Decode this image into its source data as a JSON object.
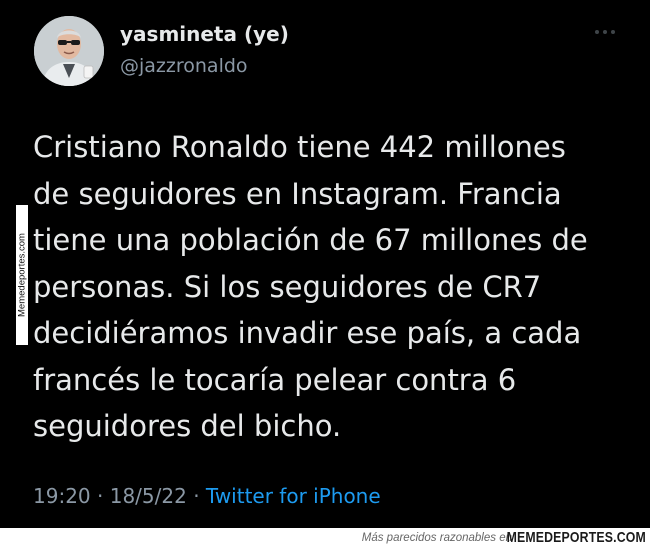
{
  "tweet": {
    "display_name": "yasmineta (ye)",
    "handle": "@jazzronaldo",
    "more_icon": "ellipsis-icon",
    "text": "Cristiano Ronaldo tiene 442 millones\nde seguidores en Instagram. Francia\ntiene una población de 67 millones de\npersonas. Si los seguidores de CR7\ndecidiéramos invadir ese país, a cada\nfrancés le tocaría pelear contra 6\nseguidores del bicho.",
    "time": "19:20",
    "separator": "·",
    "date": "18/5/22",
    "source": "Twitter for iPhone",
    "link_color": "#1d9bf0"
  },
  "watermark": {
    "side": "Memedeportes.com",
    "footer_text": "Más parecidos razonables en",
    "footer_brand": "MEMEDEPORTES.COM"
  }
}
